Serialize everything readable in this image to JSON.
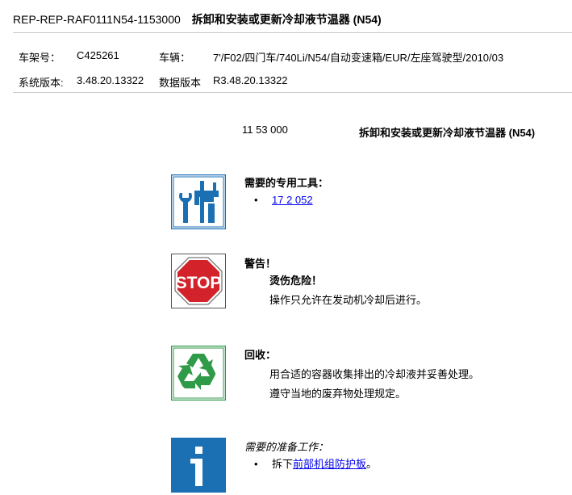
{
  "header": {
    "doc_id": "REP-REP-RAF0111N54-1153000",
    "title": "拆卸和安装或更新冷却液节温器 (N54)"
  },
  "vehicle": {
    "vin_label": "车架号：",
    "vin_value": "C425261",
    "model_label": "车辆：",
    "model_value": "7'/F02/四门车/740Li/N54/自动变速箱/EUR/左座驾驶型/2010/03",
    "sys_label": "系统版本:",
    "sys_value": "3.48.20.13322",
    "data_label": "数据版本",
    "data_value": "R3.48.20.13322"
  },
  "procedure": {
    "code": "11 53 000",
    "title": "拆卸和安装或更新冷却液节温器 (N54)"
  },
  "tools": {
    "icon": "special-tools-icon",
    "heading": "需要的专用工具：",
    "items": [
      "17 2 052"
    ]
  },
  "warning": {
    "icon": "stop-sign-icon",
    "sign_text": "STOP",
    "heading": "警告！",
    "subheading": "烫伤危险！",
    "text": "操作只允许在发动机冷却后进行。"
  },
  "recycling": {
    "icon": "recycling-icon",
    "heading": "回收：",
    "lines": [
      "用合适的容器收集排出的冷却液并妥善处理。",
      "遵守当地的废弃物处理规定。"
    ]
  },
  "preparation": {
    "icon": "info-icon",
    "heading": "需要的准备工作：",
    "item_prefix": "拆下",
    "item_link": "前部机组防护板",
    "item_suffix": "。"
  },
  "colors": {
    "icon_blue": "#1b6fb3",
    "icon_green": "#2f9a48",
    "stop_red": "#d3222a",
    "link": "#0000ee"
  }
}
